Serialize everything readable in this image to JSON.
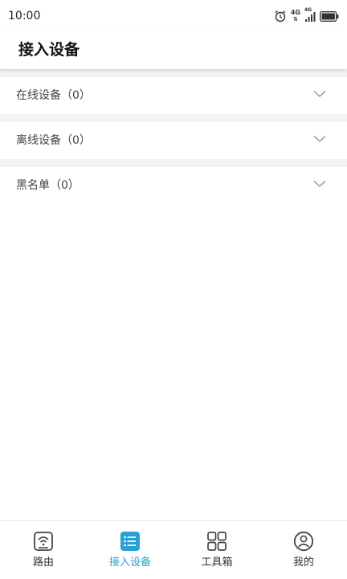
{
  "status_bar": {
    "time": "10:00",
    "network_label": "4G",
    "network_label_2": "4G",
    "icons": [
      "alarm-icon",
      "network-4g-icon",
      "signal-icon",
      "battery-icon"
    ]
  },
  "header": {
    "title": "接入设备"
  },
  "groups": [
    {
      "label": "在线设备（0）"
    },
    {
      "label": "离线设备（0）"
    },
    {
      "label": "黑名单（0）"
    }
  ],
  "tabs": [
    {
      "label": "路由",
      "icon": "router-icon",
      "active": false
    },
    {
      "label": "接入设备",
      "icon": "device-list-icon",
      "active": true
    },
    {
      "label": "工具箱",
      "icon": "toolbox-icon",
      "active": false
    },
    {
      "label": "我的",
      "icon": "profile-icon",
      "active": false
    }
  ],
  "colors": {
    "accent": "#2a9fd6",
    "background_gap": "#f2f3f5",
    "text": "#333333"
  }
}
